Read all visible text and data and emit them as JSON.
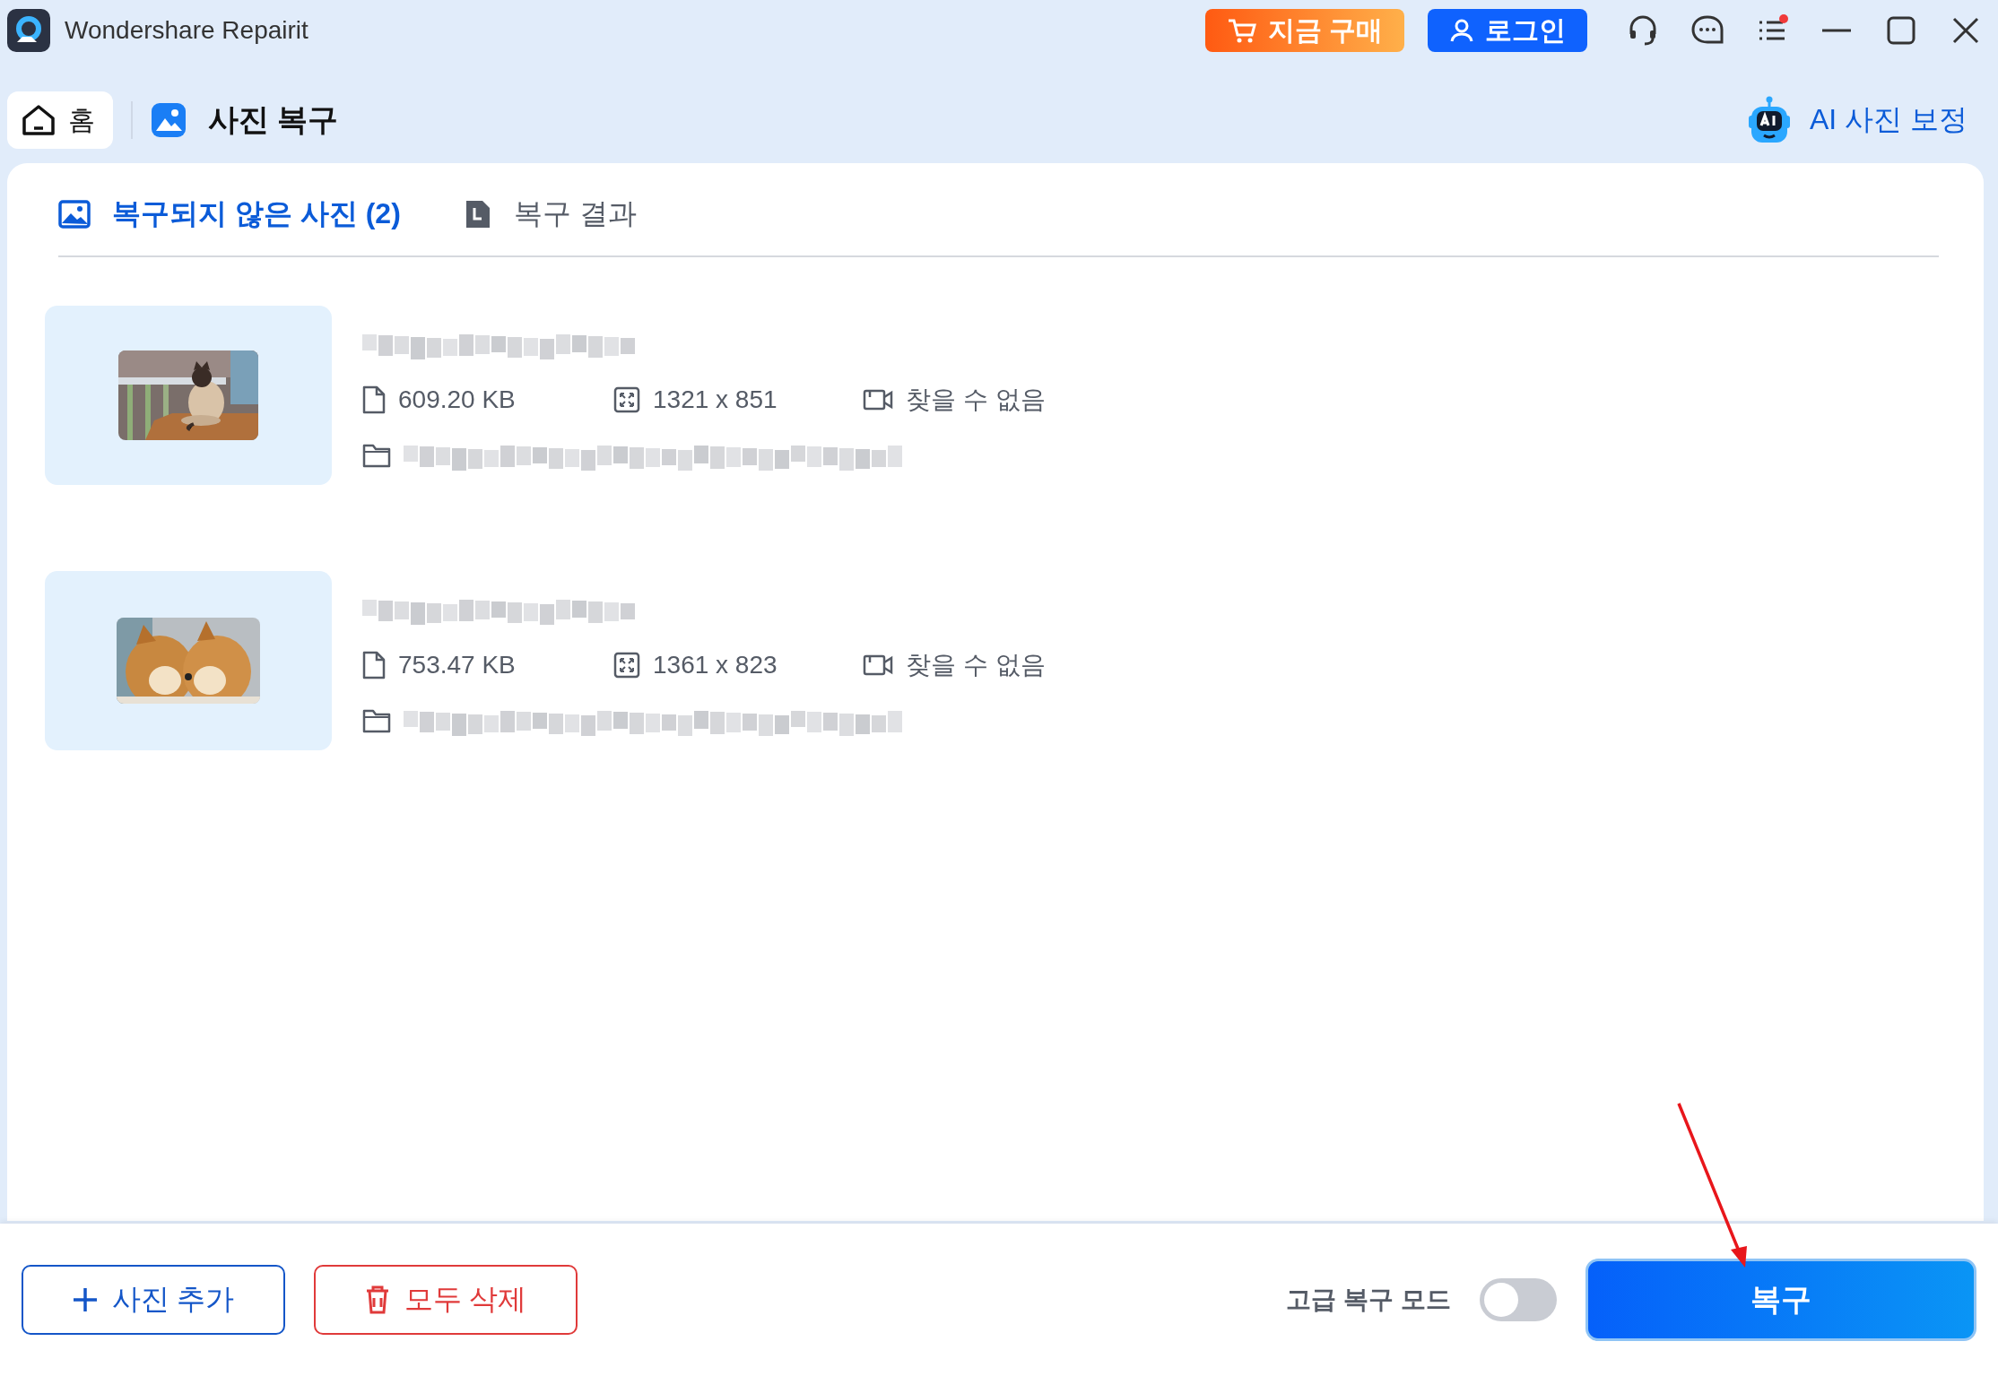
{
  "window": {
    "title": "Wondershare Repairit"
  },
  "header_buttons": [
    {
      "kind": "buy",
      "label": "지금 구매"
    },
    {
      "kind": "login",
      "label": "로그인"
    }
  ],
  "nav": {
    "home": "홈",
    "section": "사진 복구",
    "ai_link": "AI 사진 보정"
  },
  "tabs": [
    {
      "kind": "photos",
      "label": "복구되지 않은 사진 (2)",
      "selected": true
    },
    {
      "kind": "results",
      "label": "복구 결과",
      "selected": false
    }
  ],
  "photos": [
    {
      "kind": "picture",
      "size": "609.20 KB",
      "resolution": "1321 x 851",
      "device": "찾을 수 없음"
    },
    {
      "kind": "picture",
      "size": "753.47 KB",
      "resolution": "1361 x 823",
      "device": "찾을 수 없음"
    }
  ],
  "footer": {
    "add_button": "사진 추가",
    "delete_button": "모두 삭제",
    "advanced_label": "고급 복구 모드",
    "advanced_on": false,
    "repair_button": "복구"
  }
}
